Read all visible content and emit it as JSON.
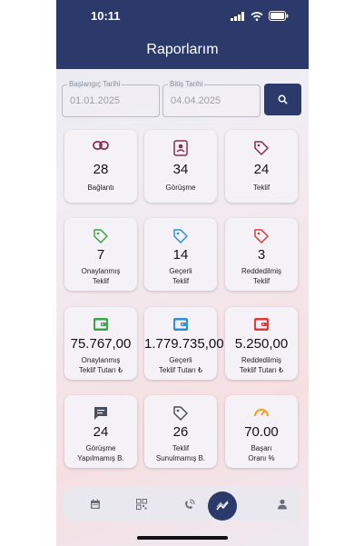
{
  "status": {
    "time": "10:11"
  },
  "header": {
    "title": "Raporlarım"
  },
  "filters": {
    "start": {
      "label": "Başlangıç Tarihi",
      "value": "01.01.2025"
    },
    "end": {
      "label": "Bitiş Tarihi",
      "value": "04.04.2025"
    }
  },
  "cards": [
    {
      "value": "28",
      "label1": "Bağlantı",
      "label2": "",
      "icon": "link-icon",
      "color": "#8a2c52"
    },
    {
      "value": "34",
      "label1": "Görüşme",
      "label2": "",
      "icon": "contact-card-icon",
      "color": "#8a2c52"
    },
    {
      "value": "24",
      "label1": "Teklif",
      "label2": "",
      "icon": "tag-icon",
      "color": "#8a2c52"
    },
    {
      "value": "7",
      "label1": "Onaylanmış",
      "label2": "Teklif",
      "icon": "tag-icon",
      "color": "#3aa64a"
    },
    {
      "value": "14",
      "label1": "Geçerli",
      "label2": "Teklif",
      "icon": "tag-icon",
      "color": "#2f8fd6"
    },
    {
      "value": "3",
      "label1": "Reddedilmiş",
      "label2": "Teklif",
      "icon": "tag-icon",
      "color": "#e0393a"
    },
    {
      "value": "75.767,00",
      "label1": "Onaylanmış",
      "label2": "Teklif Tutarı ₺",
      "icon": "wallet-icon",
      "color": "#3aa64a"
    },
    {
      "value": "1.779.735,00",
      "label1": "Geçerli",
      "label2": "Teklif Tutarı ₺",
      "icon": "wallet-icon",
      "color": "#2f8fd6"
    },
    {
      "value": "5.250,00",
      "label1": "Reddedilmiş",
      "label2": "Teklif Tutarı ₺",
      "icon": "wallet-icon",
      "color": "#e0393a"
    },
    {
      "value": "24",
      "label1": "Görüşme",
      "label2": "Yapılmamış B.",
      "icon": "chat-icon",
      "color": "#4a4f5e"
    },
    {
      "value": "26",
      "label1": "Teklif",
      "label2": "Sunulmamış B.",
      "icon": "tag-icon",
      "color": "#4a4f5e"
    },
    {
      "value": "70.00",
      "label1": "Başarı",
      "label2": "Oranı %",
      "icon": "speedometer-icon",
      "color": "#f2a12b"
    }
  ],
  "nav": [
    "calendar-icon",
    "qr-code-icon",
    "phone-signal-icon",
    "trend-chart-icon",
    "person-icon"
  ]
}
